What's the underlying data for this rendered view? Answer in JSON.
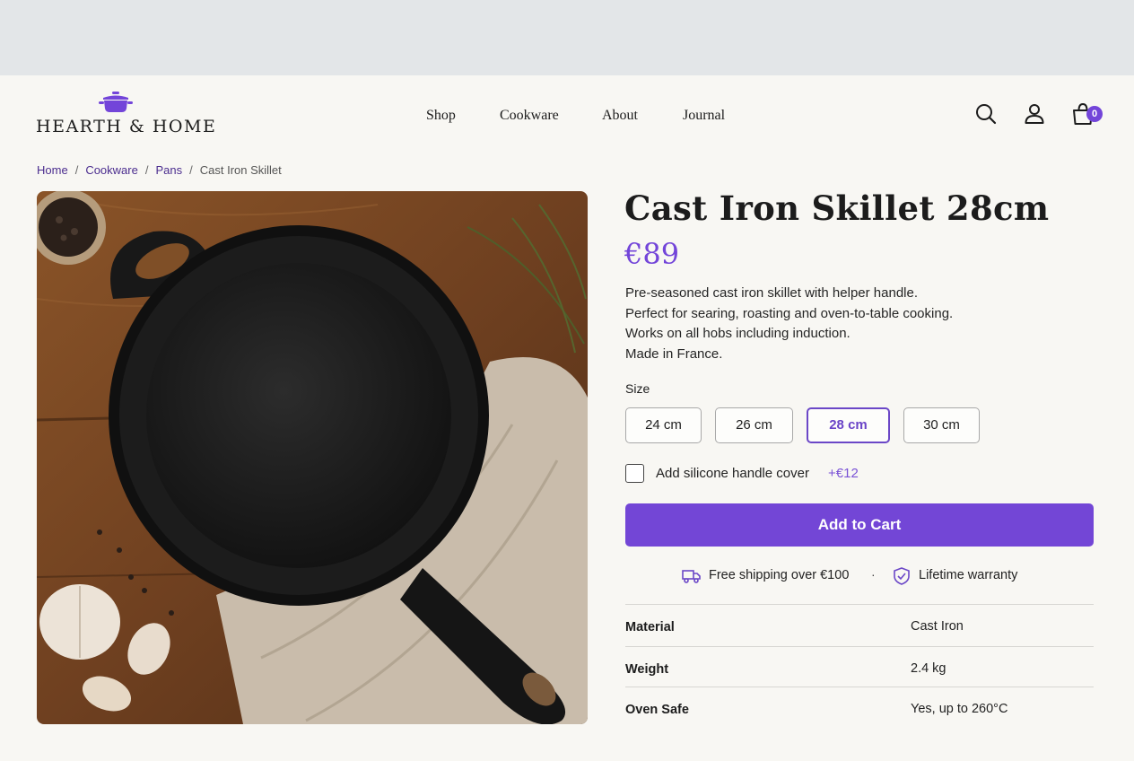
{
  "brand": {
    "name": "HEARTH & HOME",
    "accent": "#7345d9"
  },
  "nav": {
    "items": [
      "Shop",
      "Cookware",
      "About",
      "Journal"
    ]
  },
  "header": {
    "cart_count": "0"
  },
  "breadcrumb": {
    "items": [
      "Home",
      "Cookware",
      "Pans"
    ],
    "current": "Cast Iron Skillet"
  },
  "product": {
    "title": "Cast Iron Skillet 28cm",
    "price": "€89",
    "description": [
      "Pre-seasoned cast iron skillet with helper handle.",
      "Perfect for searing, roasting and oven-to-table cooking.",
      "Works on all hobs including induction.",
      "Made in France."
    ],
    "size_label": "Size",
    "sizes": [
      "24 cm",
      "26 cm",
      "28 cm",
      "30 cm"
    ],
    "selected_size": "28 cm",
    "addon": {
      "label": "Add silicone handle cover",
      "price": "+€12",
      "checked": false
    },
    "add_to_cart": "Add to Cart",
    "perks": [
      "Free shipping over €100",
      "Lifetime warranty"
    ],
    "perk_separator": "·",
    "specs": [
      {
        "key": "Material",
        "value": "Cast Iron"
      },
      {
        "key": "Weight",
        "value": "2.4 kg"
      },
      {
        "key": "Oven Safe",
        "value": "Yes, up to 260°C"
      }
    ]
  },
  "icons": {
    "search": "search-icon",
    "account": "user-icon",
    "cart": "shopping-bag-icon",
    "shipping": "truck-icon",
    "warranty": "shield-check-icon"
  }
}
